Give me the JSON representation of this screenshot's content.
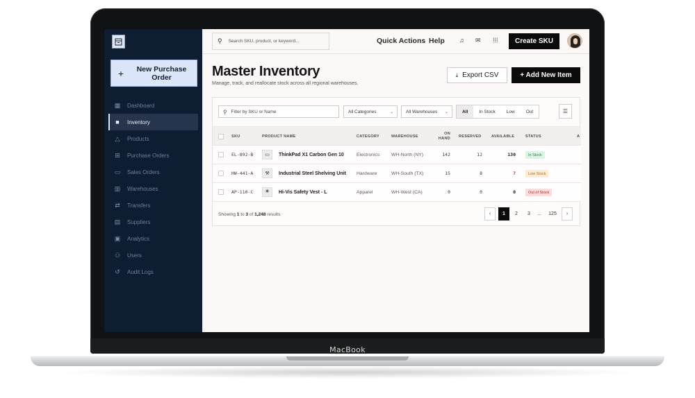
{
  "device": {
    "brand": "MacBook"
  },
  "sidebar": {
    "new_button_label": "New Purchase Order",
    "items": [
      {
        "label": "Dashboard",
        "icon": "dashboard-icon"
      },
      {
        "label": "Inventory",
        "icon": "inventory-icon",
        "active": true
      },
      {
        "label": "Products",
        "icon": "products-icon"
      },
      {
        "label": "Purchase Orders",
        "icon": "cart-icon"
      },
      {
        "label": "Sales Orders",
        "icon": "truck-icon"
      },
      {
        "label": "Warehouses",
        "icon": "warehouse-icon"
      },
      {
        "label": "Transfers",
        "icon": "transfer-icon"
      },
      {
        "label": "Suppliers",
        "icon": "document-icon"
      },
      {
        "label": "Analytics",
        "icon": "analytics-icon"
      },
      {
        "label": "Users",
        "icon": "users-icon"
      },
      {
        "label": "Audit Logs",
        "icon": "history-icon"
      }
    ]
  },
  "topbar": {
    "search_placeholder": "Search SKU, product, or keyword...",
    "quick_actions": "Quick Actions",
    "help": "Help",
    "create_sku": "Create SKU"
  },
  "page": {
    "title": "Master Inventory",
    "subtitle": "Manage, track, and reallocate stock across all regional warehouses.",
    "export_label": "Export CSV",
    "add_label": "+ Add New Item"
  },
  "filters": {
    "search_placeholder": "Filter by SKU or Name",
    "category": "All Categories",
    "warehouse": "All Warehouses",
    "segments": [
      "All",
      "In Stock",
      "Low",
      "Out"
    ]
  },
  "table": {
    "columns": {
      "sku": "SKU",
      "product": "PRODUCT NAME",
      "category": "CATEGORY",
      "warehouse": "WAREHOUSE",
      "on_hand": "ON HAND",
      "reserved": "RESERVED",
      "available": "AVAILABLE",
      "status": "STATUS",
      "actions": "A"
    },
    "rows": [
      {
        "sku": "EL-892-B",
        "icon": "laptop-icon",
        "product": "ThinkPad X1 Carbon Gen 10",
        "category": "Electronics",
        "warehouse": "WH-North (NY)",
        "on_hand": "142",
        "reserved": "12",
        "available": "130",
        "status": "In Stock"
      },
      {
        "sku": "HW-441-A",
        "icon": "wrench-icon",
        "product": "Industrial Steel Shelving Unit",
        "category": "Hardware",
        "warehouse": "WH-South (TX)",
        "on_hand": "15",
        "reserved": "8",
        "available": "7",
        "status": "Low Stock"
      },
      {
        "sku": "AP-110-C",
        "icon": "apparel-icon",
        "product": "Hi-Vis Safety Vest - L",
        "category": "Apparel",
        "warehouse": "WH-West (CA)",
        "on_hand": "0",
        "reserved": "0",
        "available": "0",
        "status": "Out of Stock"
      }
    ]
  },
  "pagination": {
    "showing": "Showing",
    "from": "1",
    "to_word": "to",
    "to": "3",
    "of_word": "of",
    "total": "1,248",
    "results_word": "results",
    "pages": [
      "1",
      "2",
      "3",
      "...",
      "125"
    ],
    "prev": "‹",
    "next": "›"
  }
}
